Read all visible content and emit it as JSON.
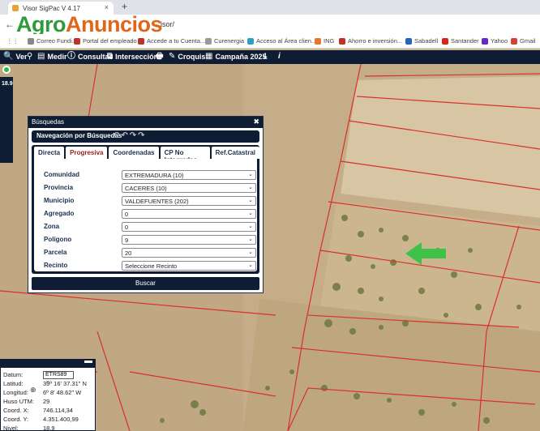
{
  "browser": {
    "tab_title": "Visor SigPac V 4.17",
    "tab_close": "×",
    "new_tab": "+",
    "back": "←",
    "url": "isor/",
    "bookmarks": [
      {
        "label": "Correo Fundi...",
        "color": "#888888"
      },
      {
        "label": "Portal del empleado",
        "color": "#c0302c"
      },
      {
        "label": "Accede a tu Cuenta...",
        "color": "#c0302c"
      },
      {
        "label": "Curenergia",
        "color": "#999999"
      },
      {
        "label": "Acceso al Área clien...",
        "color": "#2aa0c7"
      },
      {
        "label": "ING",
        "color": "#e5762b"
      },
      {
        "label": "Ahorro e inversión...",
        "color": "#c0302c"
      },
      {
        "label": "Sabadell",
        "color": "#2a66b8"
      },
      {
        "label": "Santander",
        "color": "#d9231c"
      },
      {
        "label": "Yahoo",
        "color": "#6b26c7"
      },
      {
        "label": "Gmail",
        "color": "#d4423a"
      }
    ]
  },
  "watermark": {
    "part1": "Agro",
    "part2": "Anuncios"
  },
  "toolbar": {
    "items": [
      {
        "label": "Ver",
        "icon": "search-icon",
        "glyph": "🔍"
      },
      {
        "label": "",
        "icon": "binoculars-icon",
        "glyph": "⚲"
      },
      {
        "label": "Medir",
        "icon": "ruler-icon",
        "glyph": ""
      },
      {
        "label": "Consultas",
        "icon": "info-icon",
        "glyph": "ⓘ"
      },
      {
        "label": "Intersección",
        "icon": "intersection-icon",
        "glyph": "⧉"
      },
      {
        "label": "",
        "icon": "print-icon",
        "glyph": "🖶"
      },
      {
        "label": "Croquis",
        "icon": "pencil-icon",
        "glyph": "✎"
      },
      {
        "label": "Campaña 2025",
        "icon": "calendar-icon",
        "glyph": "▦"
      },
      {
        "label": "",
        "icon": "download-icon",
        "glyph": "⤓"
      },
      {
        "label": "",
        "icon": "info-italic-icon",
        "glyph": "i"
      }
    ]
  },
  "map": {
    "zoom_level": "18.9"
  },
  "search_panel": {
    "title": "Búsquedas",
    "close": "✖",
    "nav_label": "Navegación por Búsquedas",
    "tabs": [
      {
        "label": "Directa",
        "active": false
      },
      {
        "label": "Progresiva",
        "active": true
      },
      {
        "label": "Coordenadas",
        "active": false
      },
      {
        "label": "CP No Integradas",
        "active": false
      },
      {
        "label": "Ref.Catastral",
        "active": false
      }
    ],
    "fields": [
      {
        "label": "Comunidad",
        "value": "EXTREMADURA (10)"
      },
      {
        "label": "Provincia",
        "value": "CACERES (10)"
      },
      {
        "label": "Municipio",
        "value": "VALDEFUENTES (202)"
      },
      {
        "label": "Agregado",
        "value": "0"
      },
      {
        "label": "Zona",
        "value": "0"
      },
      {
        "label": "Polígono",
        "value": "9"
      },
      {
        "label": "Parcela",
        "value": "20"
      },
      {
        "label": "Recinto",
        "value": "Seleccione Recinto"
      }
    ],
    "button": "Buscar"
  },
  "coords_panel": {
    "minimize": "▬",
    "datum_label": "Datum:",
    "datum_value": "ETRS89",
    "rows": [
      {
        "label": "Latitud:",
        "value": "39º 16' 37.31\" N"
      },
      {
        "label": "Longitud:",
        "value": "6º 8' 48.62\" W"
      },
      {
        "label": "Huso UTM:",
        "value": "29"
      },
      {
        "label": "Coord. X:",
        "value": "746.114,34"
      },
      {
        "label": "Coord. Y:",
        "value": "4.351.400,99"
      },
      {
        "label": "Nivel:",
        "value": "18.9"
      }
    ]
  },
  "colors": {
    "toolbar": "#0e1d33",
    "arrow": "#3ec24a",
    "parcel_lines": "#d9302c"
  }
}
